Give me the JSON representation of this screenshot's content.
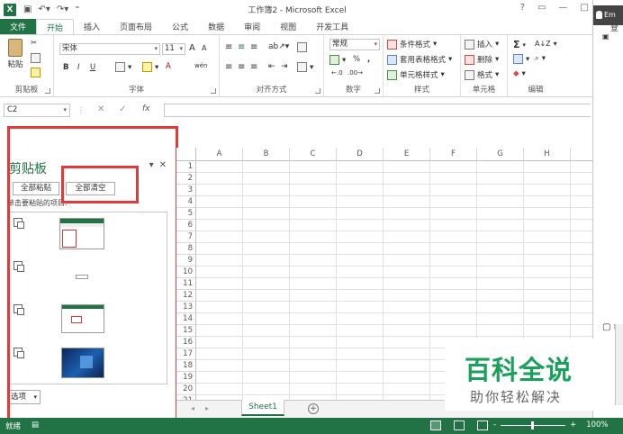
{
  "window": {
    "title": "工作簿2 - Microsoft Excel",
    "help": "?",
    "controls": [
      "▭",
      "—",
      "□"
    ],
    "app_icon": "X",
    "login": "登"
  },
  "quick_access": [
    "save-icon",
    "undo-icon",
    "redo-icon",
    "customize-icon"
  ],
  "tabs": [
    "文件",
    "开始",
    "插入",
    "页面布局",
    "公式",
    "数据",
    "审阅",
    "视图",
    "开发工具"
  ],
  "ribbon": {
    "clipboard": {
      "label": "剪贴板",
      "paste": "粘贴"
    },
    "font": {
      "label": "字体",
      "name": "宋体",
      "size": "11",
      "bold": "B",
      "italic": "I",
      "underline": "U",
      "grow": "A",
      "shrink": "A",
      "color_letter": "A",
      "wen": "wén"
    },
    "align": {
      "label": "对齐方式"
    },
    "number": {
      "label": "数字",
      "format": "常规",
      "percent": "%",
      "comma": ","
    },
    "styles": {
      "label": "样式",
      "conditional": "条件格式",
      "table": "套用表格格式",
      "cell": "单元格样式"
    },
    "cells": {
      "label": "单元格",
      "insert": "插入",
      "delete": "删除",
      "format": "格式"
    },
    "editing": {
      "label": "编辑",
      "sum": "Σ",
      "sort": "A↓Z",
      "find": "⌕",
      "clear": "◆"
    }
  },
  "formula_bar": {
    "name_box": "C2",
    "fx": "fx",
    "cancel": "✕",
    "enter": "✓",
    "value": ""
  },
  "clipboard_pane": {
    "title": "剪贴板",
    "paste_all": "全部粘贴",
    "clear_all": "全部清空",
    "hint": "单击要粘贴的项目:",
    "options": "选项",
    "items": [
      {
        "kind": "excel-screenshot"
      },
      {
        "kind": "small-rect"
      },
      {
        "kind": "excel-screenshot-red"
      },
      {
        "kind": "desktop-screenshot"
      }
    ]
  },
  "grid": {
    "columns": [
      "A",
      "B",
      "C",
      "D",
      "E",
      "F",
      "G",
      "H"
    ],
    "rows": [
      "1",
      "2",
      "3",
      "4",
      "5",
      "6",
      "7",
      "8",
      "9",
      "10",
      "11",
      "12",
      "13",
      "14",
      "15",
      "16",
      "17",
      "18",
      "19",
      "20",
      "21"
    ]
  },
  "sheet_tabs": {
    "active": "Sheet1",
    "add": "+"
  },
  "status": {
    "ready": "就绪",
    "zoom": "100%",
    "minus": "-",
    "plus": "+"
  },
  "side_window": {
    "label": "Em"
  },
  "watermark": {
    "main": "百科全说",
    "sub": "助你轻松解决"
  },
  "colors": {
    "excel_green": "#217346",
    "highlight_red": "#e03a3a",
    "watermark_green": "#1aa05a"
  }
}
